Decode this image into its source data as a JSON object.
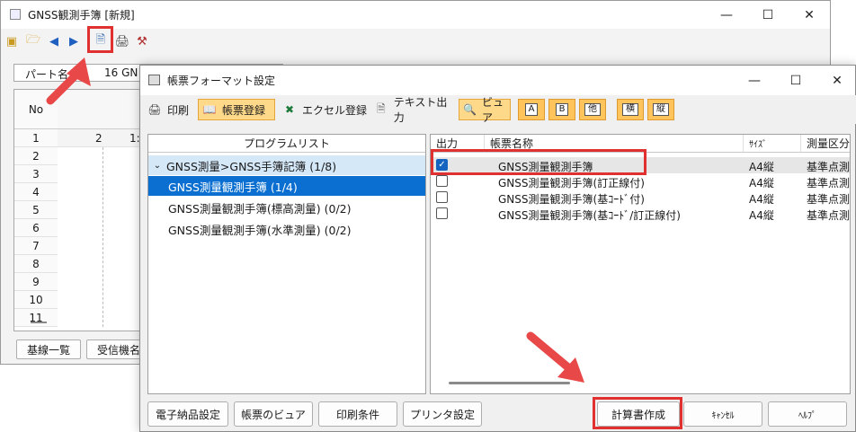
{
  "back_window": {
    "title": "GNSS観測手簿 [新規]",
    "part_label": "パート名",
    "part_value": "16 GN",
    "grid_header_no": "No",
    "first_row_values": [
      "2",
      "1:"
    ],
    "row_numbers": [
      "1",
      "2",
      "3",
      "4",
      "5",
      "6",
      "7",
      "8",
      "9",
      "10",
      "11"
    ],
    "bottom_buttons": [
      "基線一覧",
      "受信機名"
    ],
    "toolbar_icons": [
      "new-icon",
      "open-icon",
      "prev-icon",
      "next-icon",
      "report-icon",
      "print-icon",
      "settings-icon"
    ]
  },
  "dialog": {
    "title": "帳票フォーマット設定",
    "toolbar": {
      "print": "印刷",
      "form_register": "帳票登録",
      "excel_register": "エクセル登録",
      "text_output": "テキスト出力",
      "viewer": "ビュア",
      "letters": [
        "A",
        "B",
        "他"
      ],
      "orientation": [
        "横",
        "縦"
      ]
    },
    "program_list": {
      "header": "プログラムリスト",
      "items": [
        "GNSS測量>GNSS手簿記簿 (1/8)",
        "GNSS測量観測手簿 (1/4)",
        "GNSS測量観測手簿(標高測量) (0/2)",
        "GNSS測量観測手簿(水準測量) (0/2)"
      ]
    },
    "form_list": {
      "columns": [
        "出力",
        "帳票名称",
        "ｻｲｽﾞ",
        "測量区分"
      ],
      "rows": [
        {
          "checked": true,
          "name": "GNSS測量観測手簿",
          "size": "A4縦",
          "category": "基準点測"
        },
        {
          "checked": false,
          "name": "GNSS測量観測手簿(訂正線付)",
          "size": "A4縦",
          "category": "基準点測"
        },
        {
          "checked": false,
          "name": "GNSS測量観測手簿(基ｺｰﾄﾞ付)",
          "size": "A4縦",
          "category": "基準点測"
        },
        {
          "checked": false,
          "name": "GNSS測量観測手簿(基ｺｰﾄﾞ/訂正線付)",
          "size": "A4縦",
          "category": "基準点測"
        }
      ]
    },
    "bottom_buttons": {
      "electronic": "電子納品設定",
      "form_viewer": "帳票のビュア",
      "print_conditions": "印刷条件",
      "printer_settings": "プリンタ設定",
      "create": "計算書作成",
      "cancel": "ｷｬﾝｾﾙ",
      "help": "ﾍﾙﾌﾟ"
    }
  },
  "colors": {
    "highlight_red": "#e03030",
    "selection_blue": "#0a6fd0",
    "toolbar_orange": "#ffc45c"
  }
}
